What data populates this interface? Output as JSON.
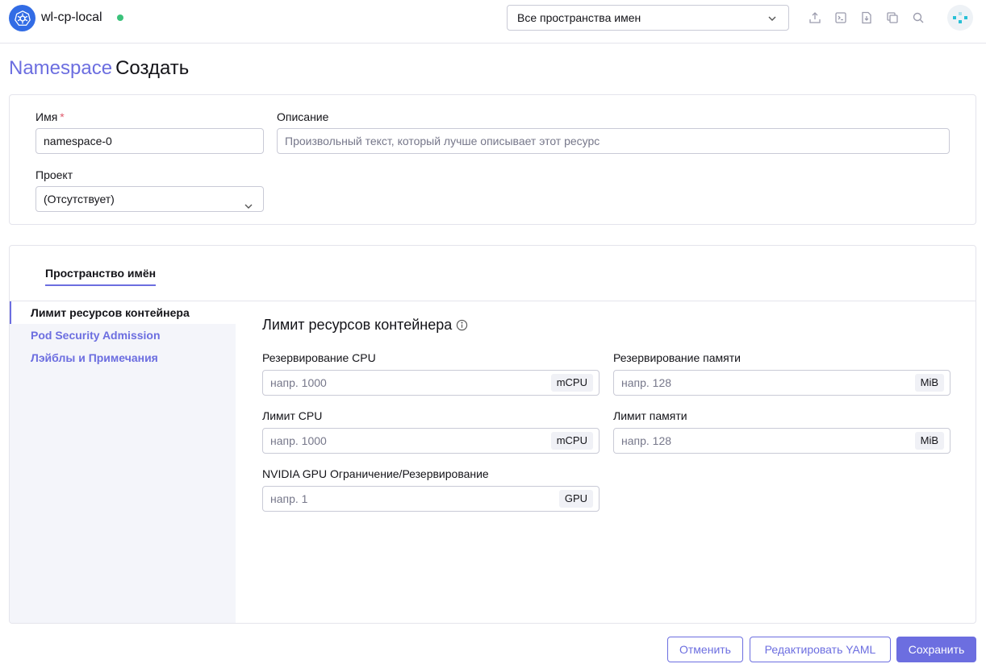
{
  "header": {
    "cluster_name": "wl-cp-local",
    "status_color": "#3bc27b",
    "namespace_filter": "Все пространства имен",
    "icons": [
      "import-yaml-icon",
      "kubectl-shell-icon",
      "download-kubeconfig-icon",
      "copy-kubeconfig-icon",
      "search-icon"
    ],
    "avatar": "user-avatar"
  },
  "page": {
    "resource": "Namespace",
    "action": "Создать"
  },
  "form": {
    "name_label": "Имя",
    "name_required": "*",
    "name_value": "namespace-0",
    "description_label": "Описание",
    "description_placeholder": "Произвольный текст, который лучше описывает этот ресурс",
    "project_label": "Проект",
    "project_value": "(Отсутствует)"
  },
  "tabs": [
    {
      "label": "Пространство имён",
      "active": true
    }
  ],
  "side_nav": [
    {
      "label": "Лимит ресурсов контейнера",
      "active": true
    },
    {
      "label": "Pod Security Admission",
      "active": false
    },
    {
      "label": "Лэйблы и Примечания",
      "active": false
    }
  ],
  "limits": {
    "title": "Лимит ресурсов контейнера",
    "cpu_reservation": {
      "label": "Резервирование CPU",
      "placeholder": "напр. 1000",
      "unit": "mCPU"
    },
    "memory_reservation": {
      "label": "Резервирование памяти",
      "placeholder": "напр. 128",
      "unit": "MiB"
    },
    "cpu_limit": {
      "label": "Лимит CPU",
      "placeholder": "напр. 1000",
      "unit": "mCPU"
    },
    "memory_limit": {
      "label": "Лимит памяти",
      "placeholder": "напр. 128",
      "unit": "MiB"
    },
    "gpu": {
      "label": "NVIDIA GPU Ограничение/Резервирование",
      "placeholder": "напр. 1",
      "unit": "GPU"
    }
  },
  "footer": {
    "cancel": "Отменить",
    "edit_yaml": "Редактировать YAML",
    "save": "Сохранить"
  },
  "colors": {
    "accent": "#6c6ee0",
    "k8s_blue": "#326ce5"
  }
}
